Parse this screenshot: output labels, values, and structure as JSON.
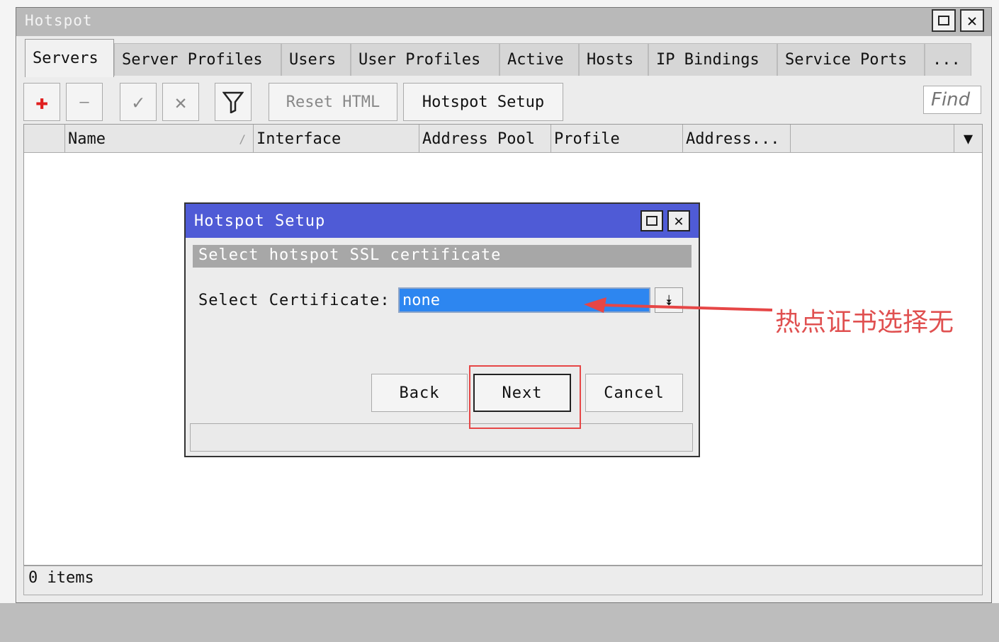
{
  "window": {
    "title": "Hotspot",
    "maximize_icon": "maximize-icon",
    "close_icon": "close-icon",
    "close_glyph": "✕"
  },
  "tabs": [
    {
      "label": "Servers",
      "active": true
    },
    {
      "label": "Server Profiles"
    },
    {
      "label": "Users"
    },
    {
      "label": "User Profiles"
    },
    {
      "label": "Active"
    },
    {
      "label": "Hosts"
    },
    {
      "label": "IP Bindings"
    },
    {
      "label": "Service Ports"
    },
    {
      "label": "..."
    }
  ],
  "toolbar": {
    "add_glyph": "✚",
    "remove_glyph": "—",
    "enable_glyph": "✓",
    "disable_glyph": "✕",
    "reset_html": "Reset HTML",
    "hotspot_setup": "Hotspot Setup",
    "find_placeholder": "Find",
    "add_color": "#e02020"
  },
  "table": {
    "columns": [
      "Name",
      "Interface",
      "Address Pool",
      "Profile",
      "Address..."
    ],
    "sort_glyph": "/",
    "menu_glyph": "▼",
    "status": "0 items"
  },
  "dialog": {
    "title": "Hotspot Setup",
    "step": "Select hotspot SSL certificate",
    "cert_label": "Select Certificate:",
    "cert_value": "none",
    "dropdown_glyph": "⯯",
    "back": "Back",
    "next": "Next",
    "cancel": "Cancel",
    "title_color": "#4f5bd6"
  },
  "annotation": {
    "text": "热点证书选择无",
    "color": "#e05050"
  }
}
